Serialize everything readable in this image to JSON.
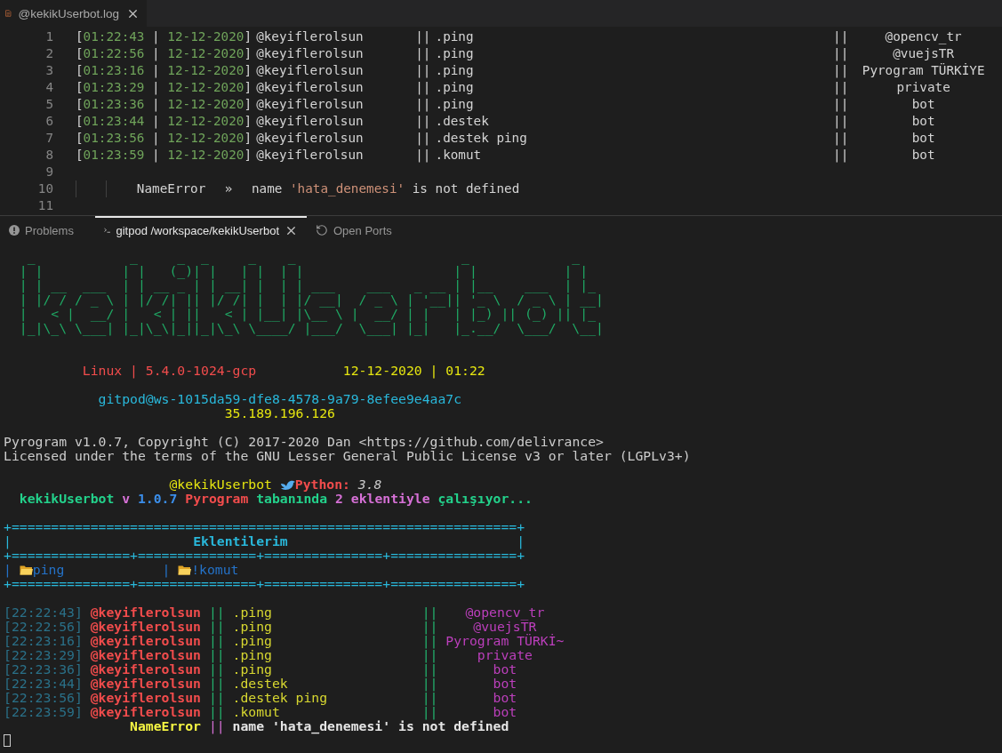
{
  "editor": {
    "tab": {
      "title": "@kekikUserbot.log"
    },
    "separators": {
      "open": "[",
      "mid": " | ",
      "close": "]",
      "divider": "||"
    },
    "lines": [
      {
        "number": "1",
        "kind": "log",
        "time": "01:22:43",
        "date": "12-12-2020",
        "user": "@keyiflerolsun",
        "command": ".ping",
        "chat": "@opencv_tr"
      },
      {
        "number": "2",
        "kind": "log",
        "time": "01:22:56",
        "date": "12-12-2020",
        "user": "@keyiflerolsun",
        "command": ".ping",
        "chat": "@vuejsTR"
      },
      {
        "number": "3",
        "kind": "log",
        "time": "01:23:16",
        "date": "12-12-2020",
        "user": "@keyiflerolsun",
        "command": ".ping",
        "chat": "Pyrogram TÜRKİYE"
      },
      {
        "number": "4",
        "kind": "log",
        "time": "01:23:29",
        "date": "12-12-2020",
        "user": "@keyiflerolsun",
        "command": ".ping",
        "chat": "private"
      },
      {
        "number": "5",
        "kind": "log",
        "time": "01:23:36",
        "date": "12-12-2020",
        "user": "@keyiflerolsun",
        "command": ".ping",
        "chat": "bot"
      },
      {
        "number": "6",
        "kind": "log",
        "time": "01:23:44",
        "date": "12-12-2020",
        "user": "@keyiflerolsun",
        "command": ".destek",
        "chat": "bot"
      },
      {
        "number": "7",
        "kind": "log",
        "time": "01:23:56",
        "date": "12-12-2020",
        "user": "@keyiflerolsun",
        "command": ".destek ping",
        "chat": "bot"
      },
      {
        "number": "8",
        "kind": "log",
        "time": "01:23:59",
        "date": "12-12-2020",
        "user": "@keyiflerolsun",
        "command": ".komut",
        "chat": "bot"
      },
      {
        "number": "9",
        "kind": "blank"
      },
      {
        "number": "10",
        "kind": "error",
        "error": "NameError",
        "arrow": "»",
        "message": [
          {
            "text": "name ",
            "kind": "plain"
          },
          {
            "text": "'hata_denemesi'",
            "kind": "string"
          },
          {
            "text": " is not defined",
            "kind": "plain"
          }
        ]
      },
      {
        "number": "11",
        "kind": "blank"
      }
    ]
  },
  "panel": {
    "tabs": [
      {
        "label": "Problems",
        "kind": "problems",
        "selected": false
      },
      {
        "label": "gitpod /workspace/kekikUserbot",
        "kind": "terminal",
        "selected": true
      },
      {
        "label": "Open Ports",
        "kind": "ports",
        "selected": false
      }
    ]
  },
  "terminal": {
    "banner": [
      " _            _     _  _     _    _                     _             _   ",
      "| |          | |   (_)| |   | |  | |                   | |           | |  ",
      "| | __  ___  | | __ _ | | __| |  | | ___    ___   _ __ | |__    ___  | |_ ",
      "| |/ / / _ \\ | |/ /| || |/ /| |  | |/ __|  / _ \\ | '__|| '_ \\  / _ \\ | __|",
      "|   < |  __/ |   < | ||   < | |__| |\\__ \\ |  __/ | |   | |_) || (_) || |_ ",
      "|_|\\_\\ \\___| |_|\\_\\|_||_|\\_\\ \\____/ |___/  \\___| |_|   |_.__/  \\___/  \\__|"
    ],
    "system": {
      "os": "Linux | 5.4.0-1024-gcp",
      "datetime": "12-12-2020 | 01:22"
    },
    "host": "gitpod@ws-1015da59-dfe8-4578-9a79-8efee9e4aa7c",
    "ip": "35.189.196.126",
    "license": [
      "Pyrogram v1.0.7, Copyright (C) 2017-2020 Dan <https://github.com/delivrance>",
      "Licensed under the terms of the GNU Lesser General Public License v3 or later (LGPLv3+)"
    ],
    "bot_line": {
      "name": "@kekikUserbot",
      "lang_label": "Python:",
      "version": "3.8"
    },
    "status_parts": [
      {
        "text": "kekikUserbot",
        "color": "#23d18b"
      },
      {
        "text": "v",
        "color": "#d670d6"
      },
      {
        "text": "1.0.7",
        "color": "#3b8eea"
      },
      {
        "text": "Pyrogram",
        "color": "#f14c4c"
      },
      {
        "text": "tabanında",
        "color": "#23d18b"
      },
      {
        "text": "2",
        "color": "#d670d6"
      },
      {
        "text": "eklentiyle",
        "color": "#d670d6"
      },
      {
        "text": "çalışıyor...",
        "color": "#23d18b"
      }
    ],
    "plugins_table": {
      "border_top": "+================================================================+",
      "side": "|",
      "title": "Eklentilerim",
      "border_mid": "+===============+===============+===============+================+",
      "plugins": [
        "ping",
        "!komut"
      ],
      "border_bottom": "+===============+===============+===============+================+"
    },
    "log_divider": "||",
    "log": [
      {
        "time": "[22:22:43]",
        "user": "@keyiflerolsun",
        "command": ".ping",
        "chat": "@opencv_tr"
      },
      {
        "time": "[22:22:56]",
        "user": "@keyiflerolsun",
        "command": ".ping",
        "chat": "@vuejsTR"
      },
      {
        "time": "[22:23:16]",
        "user": "@keyiflerolsun",
        "command": ".ping",
        "chat": "Pyrogram TÜRKİ~"
      },
      {
        "time": "[22:23:29]",
        "user": "@keyiflerolsun",
        "command": ".ping",
        "chat": "private"
      },
      {
        "time": "[22:23:36]",
        "user": "@keyiflerolsun",
        "command": ".ping",
        "chat": "bot"
      },
      {
        "time": "[22:23:44]",
        "user": "@keyiflerolsun",
        "command": ".destek",
        "chat": "bot"
      },
      {
        "time": "[22:23:56]",
        "user": "@keyiflerolsun",
        "command": ".destek ping",
        "chat": "bot"
      },
      {
        "time": "[22:23:59]",
        "user": "@keyiflerolsun",
        "command": ".komut",
        "chat": "bot"
      }
    ],
    "error": {
      "name": "NameError",
      "divider": "||",
      "message": "name 'hata_denemesi' is not defined"
    }
  }
}
